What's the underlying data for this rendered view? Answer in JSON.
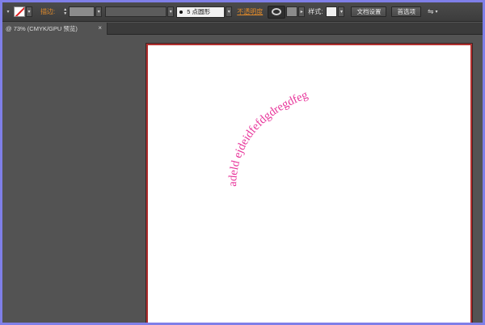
{
  "toolbar": {
    "stroke_label": "描边:",
    "brush_value": "5 点圆形",
    "opacity_label": "不透明度",
    "style_label": "样式:",
    "document_setup_button": "文档设置",
    "preferences_button": "首选项"
  },
  "document_tab": {
    "title": "@ 73% (CMYK/GPU 预览)",
    "close": "×"
  },
  "artwork": {
    "path_text": "adeld ejdeidfefdgdregdfeg",
    "text_color": "#e8369b"
  },
  "colors": {
    "artboard_border": "#b0302f",
    "label_accent": "#e08a2a",
    "window_border": "#7f7fe8"
  }
}
